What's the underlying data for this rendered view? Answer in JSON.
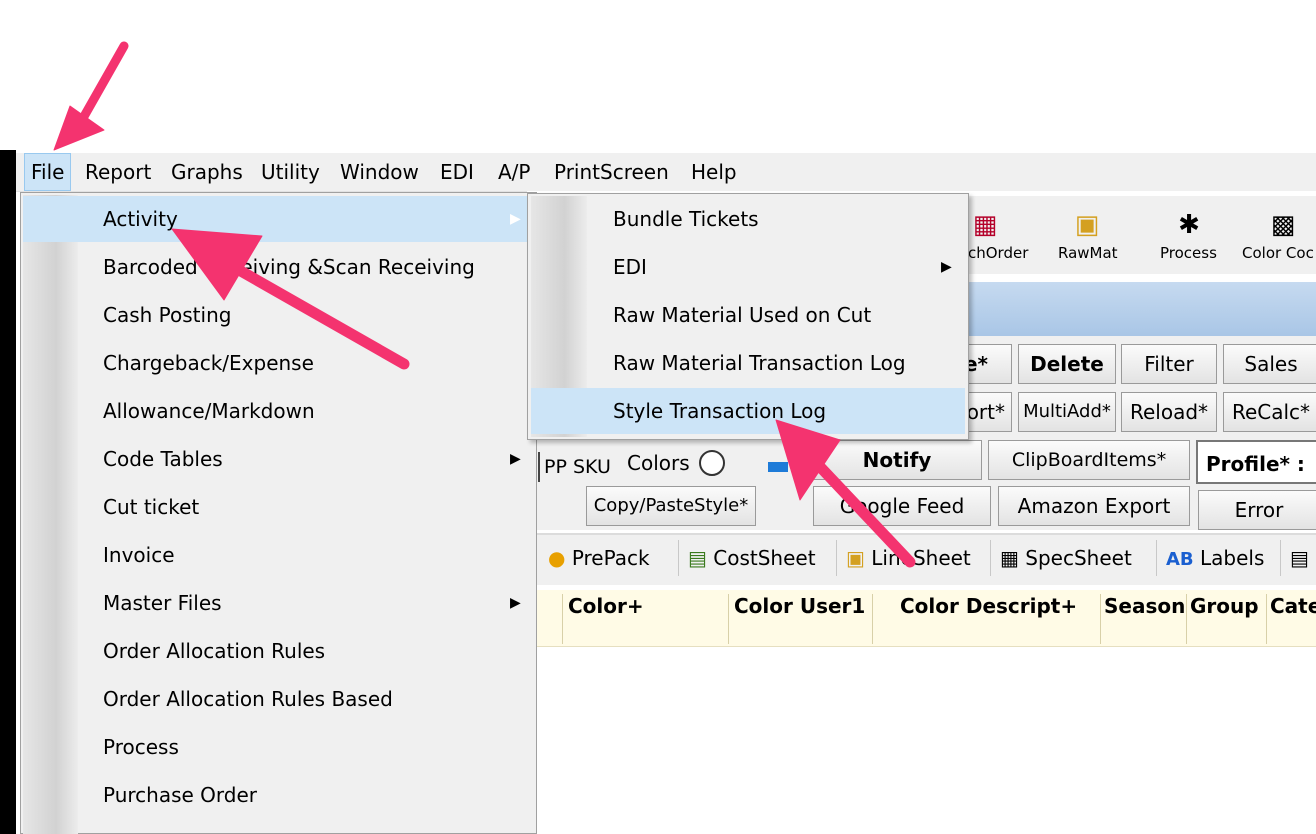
{
  "menubar": {
    "items": [
      "File",
      "Report",
      "Graphs",
      "Utility",
      "Window",
      "EDI",
      "A/P",
      "PrintScreen",
      "Help"
    ]
  },
  "toolbar": {
    "buttons": [
      "chOrder",
      "RawMat",
      "Process",
      "Color Coc"
    ]
  },
  "buttons": {
    "row1": [
      "e*",
      "Delete",
      "Filter",
      "Sales"
    ],
    "row2": [
      "ort*",
      "MultiAdd*",
      "Reload*",
      "ReCalc*"
    ],
    "row3": {
      "pp_sku": "PP SKU",
      "colors": "Colors",
      "notify": "Notify",
      "clipboard": "ClipBoardItems*",
      "profile": "Profile* :"
    },
    "row4": {
      "copy_paste": "Copy/PasteStyle*",
      "google_feed": "Google Feed",
      "amazon_export": "Amazon Export",
      "error": "Error"
    }
  },
  "icon_row": [
    "PrePack",
    "CostSheet",
    "LineSheet",
    "SpecSheet",
    "Labels"
  ],
  "icon_row_labels_ab": "AB",
  "grid": {
    "columns": [
      "Color+",
      "Color User1",
      "Color Descript+",
      "Season",
      "Group",
      "Cate"
    ]
  },
  "file_menu": {
    "items": [
      {
        "label": "Activity",
        "submenu": true
      },
      {
        "label": "Barcoded Receiving &Scan Receiving",
        "submenu": false
      },
      {
        "label": "Cash Posting",
        "submenu": false
      },
      {
        "label": "Chargeback/Expense",
        "submenu": false
      },
      {
        "label": "Allowance/Markdown",
        "submenu": false
      },
      {
        "label": "Code Tables",
        "submenu": true
      },
      {
        "label": "Cut ticket",
        "submenu": false
      },
      {
        "label": "Invoice",
        "submenu": false
      },
      {
        "label": "Master Files",
        "submenu": true
      },
      {
        "label": "Order Allocation Rules",
        "submenu": false
      },
      {
        "label": "Order Allocation Rules Based",
        "submenu": false
      },
      {
        "label": "Process",
        "submenu": false
      },
      {
        "label": "Purchase Order",
        "submenu": false
      }
    ]
  },
  "activity_submenu": {
    "items": [
      {
        "label": "Bundle Tickets",
        "submenu": false
      },
      {
        "label": "EDI",
        "submenu": true
      },
      {
        "label": "Raw Material Used on Cut",
        "submenu": false
      },
      {
        "label": "Raw Material Transaction Log",
        "submenu": false
      },
      {
        "label": "Style Transaction Log",
        "submenu": false
      }
    ]
  },
  "colors": {
    "highlight": "#cce4f7",
    "annotation_arrow": "#f4336f",
    "menu_bg": "#f0f0f0"
  }
}
